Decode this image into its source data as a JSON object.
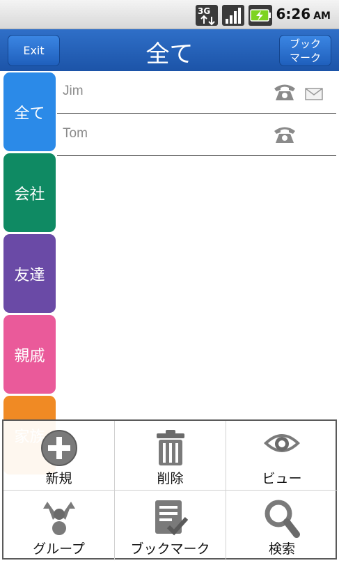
{
  "status_bar": {
    "network": "3G",
    "time": "6:26",
    "ampm": "AM"
  },
  "header": {
    "title": "全て",
    "exit_label": "Exit",
    "bookmark_label_line1": "ブック",
    "bookmark_label_line2": "マーク"
  },
  "categories": [
    {
      "label": "全て",
      "color": "#2b8ae8"
    },
    {
      "label": "会社",
      "color": "#0f8a63"
    },
    {
      "label": "友達",
      "color": "#6a4aa6"
    },
    {
      "label": "親戚",
      "color": "#ea5a9a"
    },
    {
      "label": "家族",
      "color": "#f08a24"
    }
  ],
  "contacts": [
    {
      "name": "Jim",
      "has_phone": true,
      "has_mail": true
    },
    {
      "name": "Tom",
      "has_phone": true,
      "has_mail": false
    }
  ],
  "menu": {
    "items": [
      {
        "label": "新規",
        "icon": "add-icon"
      },
      {
        "label": "削除",
        "icon": "trash-icon"
      },
      {
        "label": "ビュー",
        "icon": "eye-icon"
      },
      {
        "label": "グループ",
        "icon": "group-icon"
      },
      {
        "label": "ブックマーク",
        "icon": "bookmark-list-icon"
      },
      {
        "label": "検索",
        "icon": "search-icon"
      }
    ]
  },
  "colors": {
    "title_bar": "#1c54a8",
    "icon_gray": "#8a8a8a"
  }
}
